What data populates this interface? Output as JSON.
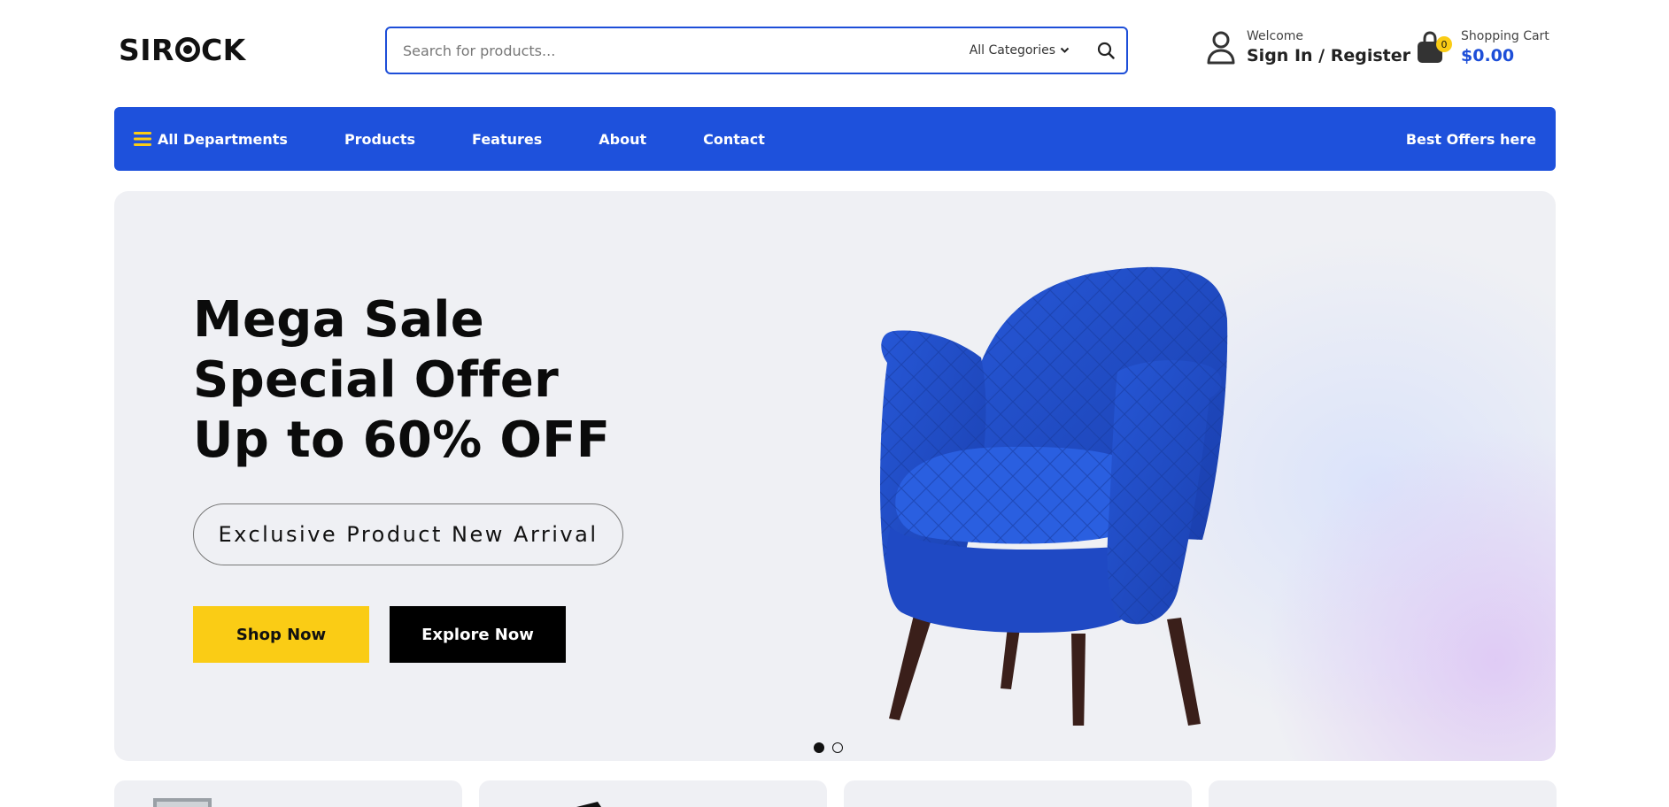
{
  "header": {
    "logo_text": "SIROCK",
    "search": {
      "placeholder": "Search for products...",
      "category_label": "All Categories"
    },
    "account": {
      "welcome": "Welcome",
      "sign_in": "Sign In / Register"
    },
    "cart": {
      "label": "Shopping Cart",
      "total": "$0.00",
      "count": "0"
    }
  },
  "nav": {
    "departments": "All Departments",
    "links": [
      "Products",
      "Features",
      "About",
      "Contact"
    ],
    "offers": "Best Offers here"
  },
  "hero": {
    "headline": "Mega Sale\nSpecial Offer\nUp to 60% OFF",
    "tagline": "Exclusive Product New Arrival",
    "shop_button": "Shop Now",
    "explore_button": "Explore Now",
    "slide_count": 2,
    "active_slide": 1
  },
  "colors": {
    "primary": "#1e51dc",
    "accent": "#facc15",
    "price": "#1d4ed8",
    "chair": "#1f49c4",
    "hero_bg": "#eff0f4"
  },
  "icons": [
    "user-icon",
    "shopping-bag-icon",
    "search-icon",
    "chevron-down-icon",
    "hamburger-menu-icon"
  ]
}
